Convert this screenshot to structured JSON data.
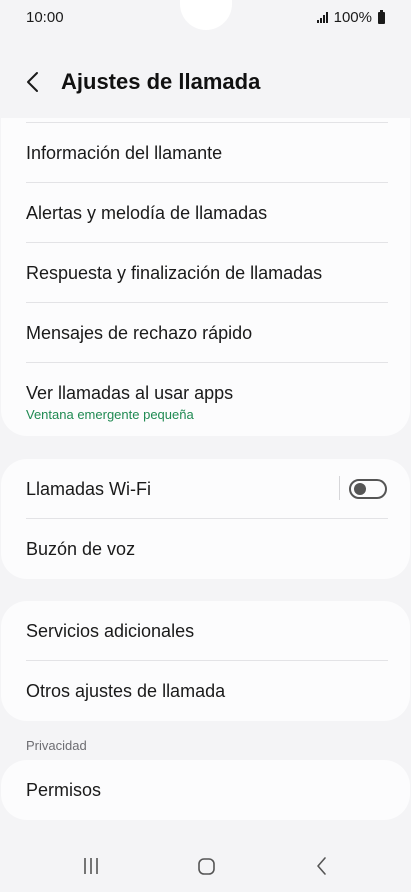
{
  "status_bar": {
    "time": "10:00",
    "battery": "100%"
  },
  "header": {
    "title": "Ajustes de llamada",
    "back_icon": "chevron-left-icon"
  },
  "group1": {
    "items": [
      {
        "label": "Información del llamante"
      },
      {
        "label": "Alertas y melodía de llamadas"
      },
      {
        "label": "Respuesta y finalización de llamadas"
      },
      {
        "label": "Mensajes de rechazo rápido"
      },
      {
        "label": "Ver llamadas al usar apps",
        "sublabel": "Ventana emergente pequeña"
      }
    ]
  },
  "group2": {
    "items": [
      {
        "label": "Llamadas Wi-Fi",
        "toggle": false
      },
      {
        "label": "Buzón de voz"
      }
    ]
  },
  "group3": {
    "items": [
      {
        "label": "Servicios adicionales"
      },
      {
        "label": "Otros ajustes de llamada"
      }
    ]
  },
  "privacy": {
    "section_title": "Privacidad",
    "items": [
      {
        "label": "Permisos"
      }
    ]
  },
  "nav_bar": {
    "recents_icon": "recents-icon",
    "home_icon": "home-icon",
    "back_icon": "back-icon"
  },
  "colors": {
    "background": "#f4f4f6",
    "card": "#fcfcfd",
    "accent_green": "#1f8a52"
  }
}
